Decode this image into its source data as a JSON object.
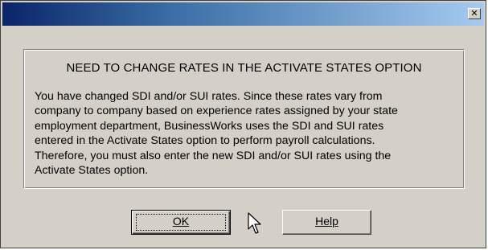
{
  "dialog": {
    "close_glyph": "✕",
    "heading": "NEED TO CHANGE RATES IN THE ACTIVATE STATES OPTION",
    "body_lines": [
      "You have changed SDI and/or SUI rates.  Since these rates vary from",
      "company to company based on experience rates assigned by your state",
      "employment department, BusinessWorks uses the SDI and SUI rates",
      "entered in the Activate States option to perform payroll calculations.",
      "Therefore, you must also enter the new SDI and/or SUI rates using the",
      "Activate States option."
    ],
    "ok_label": "OK",
    "help_label": "Help"
  },
  "colors": {
    "title_start": "#0a246a",
    "title_end": "#a6caf0",
    "face": "#d4d0c8"
  },
  "icons": {
    "close": "close-icon",
    "cursor": "mouse-pointer-icon"
  }
}
